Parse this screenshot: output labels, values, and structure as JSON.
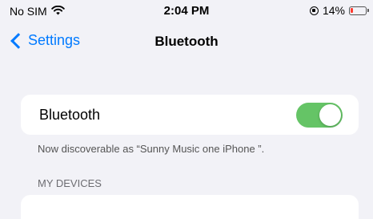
{
  "status_bar": {
    "carrier": "No SIM",
    "time": "2:04 PM",
    "battery": "14%",
    "icons": [
      "wifi-icon",
      "lock-rotation-icon",
      "battery-icon"
    ],
    "battery_level": 0.14,
    "battery_color": "#ff3b30"
  },
  "nav": {
    "back_label": "Settings",
    "title": "Bluetooth",
    "accent_color": "#007aff"
  },
  "bluetooth": {
    "label": "Bluetooth",
    "enabled": true,
    "toggle_color": "#65c466",
    "discoverable_text": "Now discoverable as “Sunny Music one iPhone ”."
  },
  "devices": {
    "section_header": "MY DEVICES"
  }
}
